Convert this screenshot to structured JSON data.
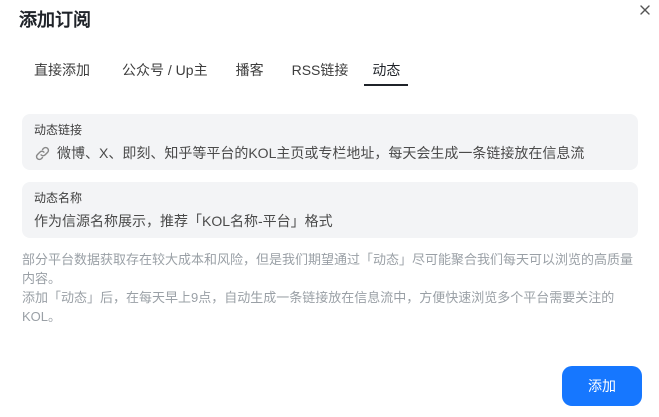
{
  "dialog": {
    "title": "添加订阅",
    "close_icon": "close-icon"
  },
  "tabs": [
    {
      "label": "直接添加",
      "active": false
    },
    {
      "label": "公众号 / Up主",
      "active": false
    },
    {
      "label": "播客",
      "active": false
    },
    {
      "label": "RSS链接",
      "active": false
    },
    {
      "label": "动态",
      "active": true
    }
  ],
  "link_field": {
    "label": "动态链接",
    "placeholder": "微博、X、即刻、知乎等平台的KOL主页或专栏地址，每天会生成一条链接放在信息流",
    "icon": "link-icon"
  },
  "name_field": {
    "label": "动态名称",
    "placeholder": "作为信源名称展示，推荐「KOL名称-平台」格式"
  },
  "note": {
    "paragraph1": "部分平台数据获取存在较大成本和风险，但是我们期望通过「动态」尽可能聚合我们每天可以浏览的高质量内容。",
    "paragraph2": "添加「动态」后，在每天早上9点，自动生成一条链接放在信息流中，方便快速浏览多个平台需要关注的KOL。"
  },
  "add_button": {
    "label": "添加"
  },
  "colors": {
    "accent": "#1677ff",
    "field_bg": "#f3f4f6",
    "note_text": "#9aa0a6"
  }
}
